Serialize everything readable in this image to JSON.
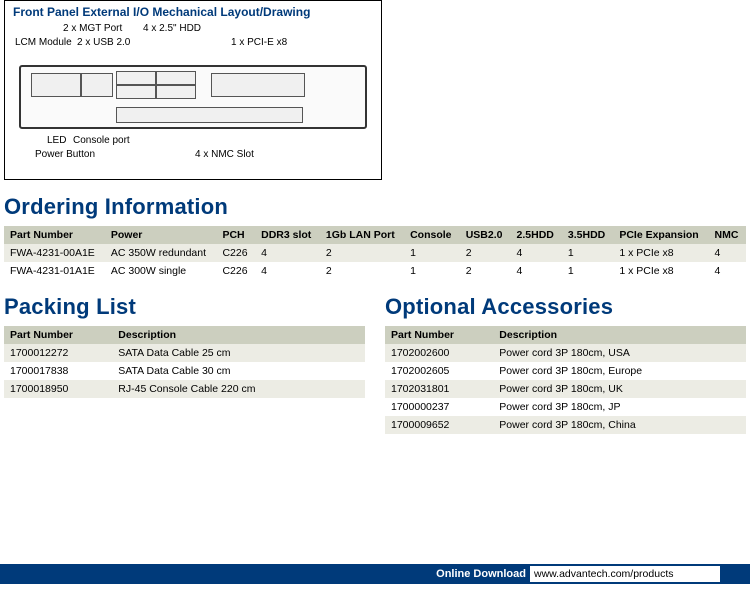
{
  "drawing": {
    "title": "Front Panel External I/O Mechanical Layout/Drawing",
    "labels_top": {
      "mgt": "2 x MGT Port",
      "hdd": "4 x 2.5\" HDD",
      "lcm": "LCM Module",
      "usb": "2 x USB 2.0",
      "pcie": "1 x PCI-E x8"
    },
    "labels_bottom": {
      "led": "LED",
      "console": "Console port",
      "power": "Power Button",
      "nmc": "4 x NMC Slot"
    }
  },
  "ordering": {
    "title": "Ordering Information",
    "headers": [
      "Part Number",
      "Power",
      "PCH",
      "DDR3 slot",
      "1Gb LAN Port",
      "Console",
      "USB2.0",
      "2.5HDD",
      "3.5HDD",
      "PCIe Expansion",
      "NMC"
    ],
    "rows": [
      [
        "FWA-4231-00A1E",
        "AC 350W redundant",
        "C226",
        "4",
        "2",
        "1",
        "2",
        "4",
        "1",
        "1 x PCIe x8",
        "4"
      ],
      [
        "FWA-4231-01A1E",
        "AC 300W single",
        "C226",
        "4",
        "2",
        "1",
        "2",
        "4",
        "1",
        "1 x PCIe x8",
        "4"
      ]
    ]
  },
  "packing": {
    "title": "Packing List",
    "headers": [
      "Part Number",
      "Description"
    ],
    "rows": [
      [
        "1700012272",
        "SATA Data Cable 25 cm"
      ],
      [
        "1700017838",
        "SATA Data Cable 30 cm"
      ],
      [
        "1700018950",
        "RJ-45 Console Cable 220 cm"
      ]
    ]
  },
  "accessories": {
    "title": "Optional Accessories",
    "headers": [
      "Part Number",
      "Description"
    ],
    "rows": [
      [
        "1702002600",
        "Power cord 3P 180cm, USA"
      ],
      [
        "1702002605",
        "Power cord 3P 180cm, Europe"
      ],
      [
        "1702031801",
        "Power cord 3P 180cm, UK"
      ],
      [
        "1700000237",
        "Power cord 3P 180cm, JP"
      ],
      [
        "1700009652",
        "Power cord 3P 180cm, China"
      ]
    ]
  },
  "footer": {
    "label": "Online Download",
    "url": "www.advantech.com/products"
  }
}
